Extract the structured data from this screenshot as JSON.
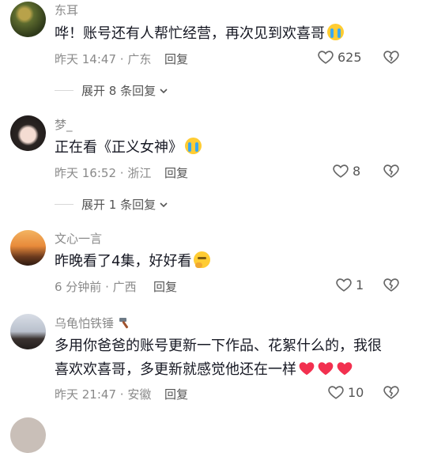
{
  "comments": [
    {
      "username": "东耳",
      "text": "哗！账号还有人帮忙经营，再次见到欢喜哥",
      "emoji": "crying-emoji",
      "time": "昨天 14:47",
      "location": "广东",
      "reply_label": "回复",
      "likes": "625",
      "replies_label": "展开 8 条回复"
    },
    {
      "username": "梦_",
      "text": "正在看《正义女神》",
      "emoji": "crying-emoji",
      "time": "昨天 16:52",
      "location": "浙江",
      "reply_label": "回复",
      "likes": "8",
      "replies_label": "展开 1 条回复"
    },
    {
      "username": "文心一言",
      "text": "昨晚看了4集，好好看",
      "emoji": "thinking-emoji",
      "time": "6 分钟前",
      "location": "广西",
      "reply_label": "回复",
      "likes": "1"
    },
    {
      "username": "乌龟怕铁锤",
      "username_emoji": "hammer-emoji",
      "text_line1": "多用你爸爸的账号更新一下作品、花絮什么的，我很",
      "text_line2": "喜欢欢喜哥，多更新就感觉他还在一样",
      "emoji": "red-heart-emoji x3",
      "time": "昨天 21:47",
      "location": "安徽",
      "reply_label": "回复",
      "likes": "10"
    }
  ],
  "colors": {
    "text": "#161823",
    "muted": "#8a8a8a",
    "heart_red": "#fe2c55"
  }
}
